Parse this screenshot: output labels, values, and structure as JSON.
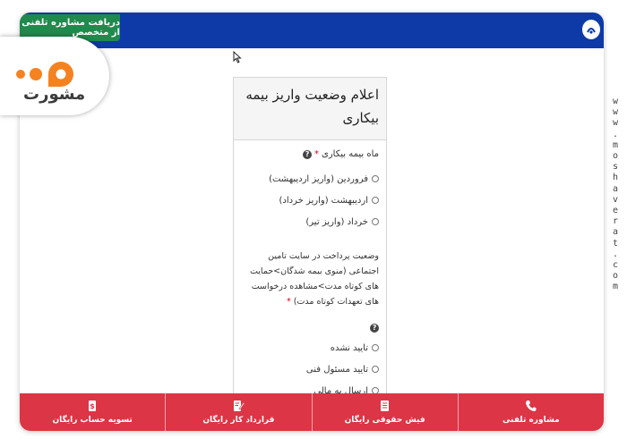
{
  "header": {
    "consult_label": "دریافت مشاوره تلفنی از متخصص"
  },
  "form": {
    "title": "اعلام وضعیت واریز بیمه بیکاری",
    "q1": {
      "label": "ماه بیمه بیکاری",
      "required_mark": "*",
      "help_glyph": "?",
      "options": [
        "فروردین (واریز اردیبهشت)",
        "اردیبهشت (واریز خرداد)",
        "خرداد (واریز تیر)"
      ]
    },
    "q2": {
      "label": "وضعیت پرداخت در سایت تامین اجتماعی (منوی بیمه شدگان>حمایت های کوتاه مدت>مشاهده درخواست های تعهدات کوتاه مدت)",
      "required_mark": "*",
      "help_glyph": "?",
      "options": [
        "تایید نشده",
        "تایید مسئول فنی",
        "ارسال به مالی"
      ]
    }
  },
  "bottom_nav": [
    {
      "label": "مشاوره تلفنی",
      "icon": "phone-icon"
    },
    {
      "label": "فیش حقوقی رایگان",
      "icon": "document-icon"
    },
    {
      "label": "قرارداد کار رایگان",
      "icon": "contract-icon"
    },
    {
      "label": "تسویه حساب رایگان",
      "icon": "money-icon"
    }
  ],
  "brand": {
    "text": "مشورت",
    "watermark": "www.moshaverat.com"
  },
  "colors": {
    "header_blue": "#0d3aa6",
    "consult_green": "#1f8a4c",
    "bottom_red": "#dc3545",
    "brand_orange": "#f58220",
    "brand_blue": "#1f5fa8"
  }
}
